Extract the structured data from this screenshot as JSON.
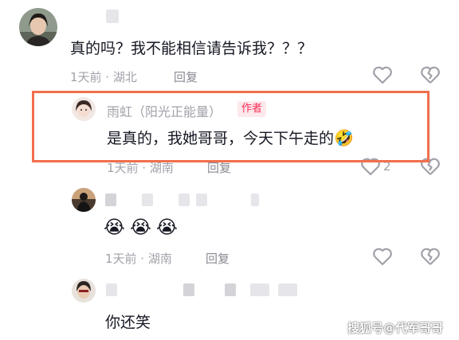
{
  "comments": [
    {
      "text": "真的吗？我不能相信请告诉我？？？",
      "meta": "1天前 · 湖北",
      "reply": "回复"
    },
    {
      "username": "雨虹（阳光正能量）",
      "badge": "作者",
      "text": "是真的，我她哥哥，今天下午走的",
      "text_emoji": "🤣",
      "meta": "1天前 · 湖南",
      "reply": "回复",
      "like_count": "2"
    },
    {
      "emojis": [
        "😭",
        "😭",
        "😭"
      ],
      "meta": "1天前 · 湖南",
      "reply": "回复"
    },
    {
      "text": "你还笑"
    }
  ],
  "watermark": "搜狐号@代军哥哥",
  "colors": {
    "highlight_border": "#f26f4c",
    "author_badge": "#fe2c55",
    "meta_text": "#a1a1aa"
  },
  "icons": [
    "heart-icon",
    "broken-heart-icon"
  ]
}
